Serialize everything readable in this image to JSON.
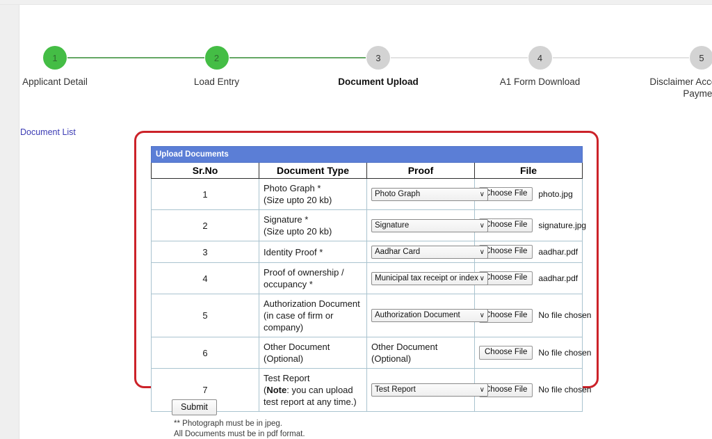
{
  "stepper": {
    "steps": [
      {
        "num": "1",
        "label": "Applicant Detail",
        "state": "done",
        "current": false
      },
      {
        "num": "2",
        "label": "Load Entry",
        "state": "done",
        "current": false
      },
      {
        "num": "3",
        "label": "Document Upload",
        "state": "current",
        "current": true
      },
      {
        "num": "4",
        "label": "A1 Form Download",
        "state": "todo",
        "current": false
      },
      {
        "num": "5",
        "label": "Disclaimer Acceptance & Payment",
        "state": "todo",
        "current": false
      }
    ],
    "connector_done_color": "#63a763",
    "connector_todo_color": "#e2e2e2",
    "circle_done_color": "#44bd45",
    "circle_todo_color": "#d3d3d3"
  },
  "links": {
    "document_list": "Document List",
    "document_list_color": "#3c3cb4"
  },
  "highlight": {
    "border_color": "#cc2229"
  },
  "table": {
    "title": "Upload Documents",
    "title_bg": "#5b7ed6",
    "columns": [
      "Sr.No",
      "Document Type",
      "Proof",
      "File"
    ],
    "choose_file_label": "Choose File",
    "no_file_label": "No file chosen",
    "rows": [
      {
        "srno": "1",
        "type_line1": "Photo Graph *",
        "type_line2": "(Size upto 20 kb)",
        "proof_kind": "select",
        "proof_value": "Photo Graph",
        "file_name": "photo.jpg"
      },
      {
        "srno": "2",
        "type_line1": "Signature *",
        "type_line2": "(Size upto 20 kb)",
        "proof_kind": "select",
        "proof_value": "Signature",
        "file_name": "signature.jpg"
      },
      {
        "srno": "3",
        "type_line1": "Identity Proof *",
        "type_line2": "",
        "proof_kind": "select",
        "proof_value": "Aadhar Card",
        "file_name": "aadhar.pdf"
      },
      {
        "srno": "4",
        "type_line1": "Proof of ownership /",
        "type_line2": "occupancy *",
        "proof_kind": "select",
        "proof_value": "Municipal tax receipt or index",
        "file_name": "aadhar.pdf"
      },
      {
        "srno": "5",
        "type_line1": "Authorization Document",
        "type_line2": "(in case of firm or",
        "type_line3": "company)",
        "proof_kind": "select",
        "proof_value": "Authorization Document",
        "file_name": "No file chosen"
      },
      {
        "srno": "6",
        "type_line1": "Other Document",
        "type_line2": "(Optional)",
        "proof_kind": "text",
        "proof_text_line1": "Other Document",
        "proof_text_line2": "(Optional)",
        "file_name": "No file chosen"
      },
      {
        "srno": "7",
        "type_line1": "Test Report",
        "type_note_bold": "Note",
        "type_note_rest": ": you can upload",
        "type_line3": "test report at any time.)",
        "proof_kind": "select",
        "proof_value": "Test Report",
        "file_name": "No file chosen"
      }
    ]
  },
  "footer": {
    "submit_label": "Submit",
    "note_line1": "** Photograph must be in jpeg.",
    "note_line2": "All Documents must be in pdf format."
  }
}
